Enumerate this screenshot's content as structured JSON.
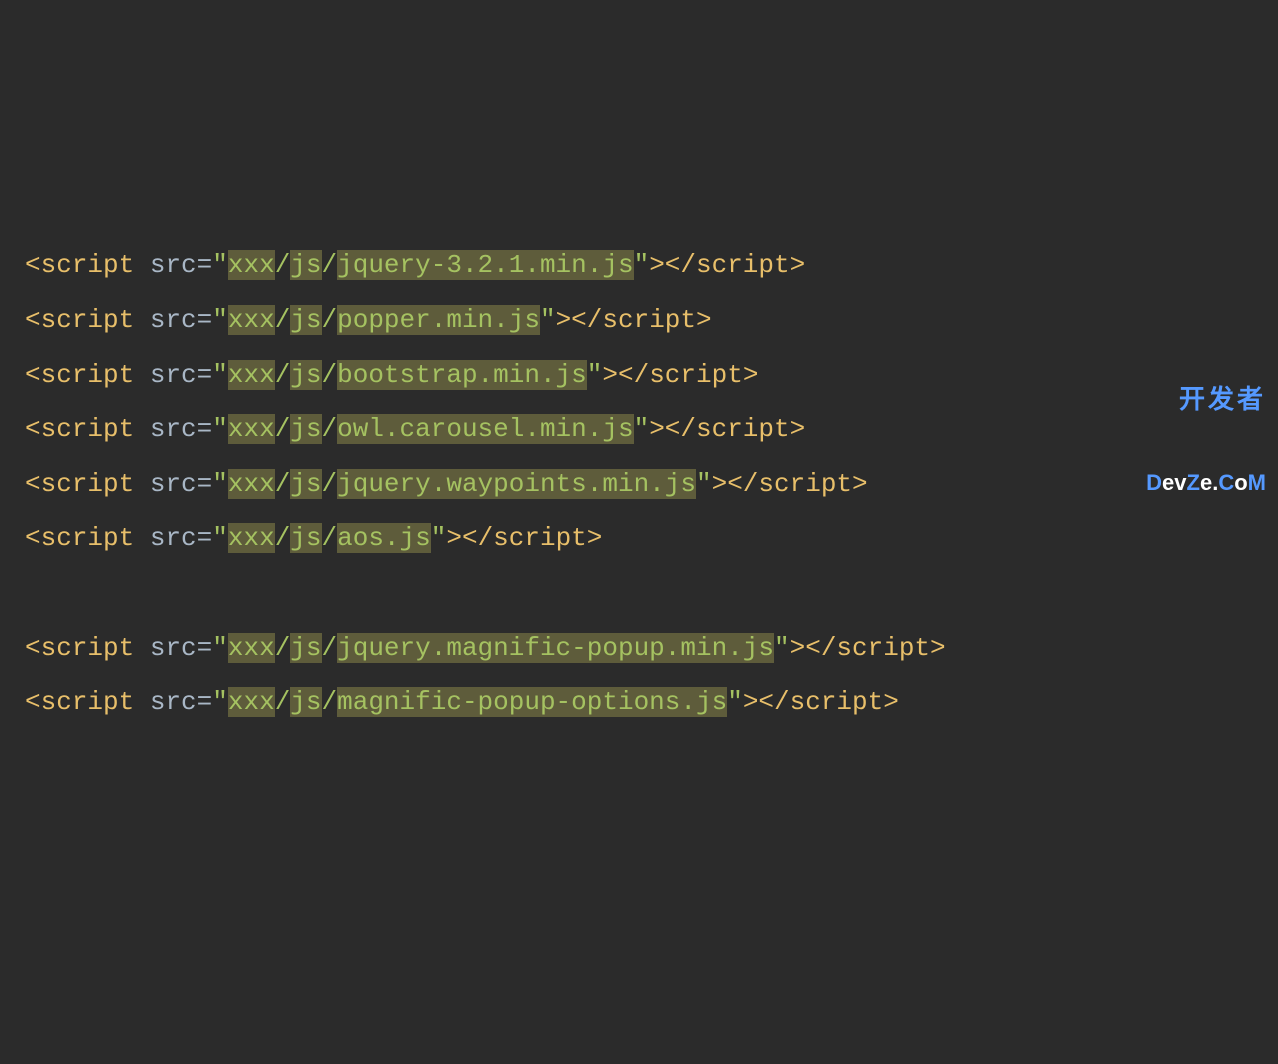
{
  "code": {
    "lines": [
      {
        "tag": "script",
        "attr": "src",
        "segments": [
          "xxx",
          "/",
          "js",
          "/",
          "jquery-3.2.1.min.js"
        ],
        "highlights": [
          true,
          false,
          true,
          false,
          true
        ]
      },
      {
        "tag": "script",
        "attr": "src",
        "segments": [
          "xxx",
          "/",
          "js",
          "/",
          "popper.min.js"
        ],
        "highlights": [
          true,
          false,
          true,
          false,
          true
        ]
      },
      {
        "tag": "script",
        "attr": "src",
        "segments": [
          "xxx",
          "/",
          "js",
          "/",
          "bootstrap.min.js"
        ],
        "highlights": [
          true,
          false,
          true,
          false,
          true
        ]
      },
      {
        "tag": "script",
        "attr": "src",
        "segments": [
          "xxx",
          "/",
          "js",
          "/",
          "owl.carousel.min.js"
        ],
        "highlights": [
          true,
          false,
          true,
          false,
          true
        ]
      },
      {
        "tag": "script",
        "attr": "src",
        "segments": [
          "xxx",
          "/",
          "js",
          "/",
          "jquery.waypoints.min.js"
        ],
        "highlights": [
          true,
          false,
          true,
          false,
          true
        ]
      },
      {
        "tag": "script",
        "attr": "src",
        "segments": [
          "xxx",
          "/",
          "js",
          "/",
          "aos.js"
        ],
        "highlights": [
          true,
          false,
          true,
          false,
          true
        ]
      },
      {
        "blank": true
      },
      {
        "tag": "script",
        "attr": "src",
        "segments": [
          "xxx",
          "/",
          "js",
          "/",
          "jquery.magnific-popup.min.js"
        ],
        "highlights": [
          true,
          false,
          true,
          false,
          true
        ]
      },
      {
        "tag": "script",
        "attr": "src",
        "segments": [
          "xxx",
          "/",
          "js",
          "/",
          "magnific-popup-options.js"
        ],
        "highlights": [
          true,
          false,
          true,
          false,
          true
        ]
      }
    ]
  },
  "watermark": {
    "top": "开发者",
    "bottom_prefix": "D",
    "bottom_mid": "ev",
    "bottom_z": "Z",
    "bottom_e": "e",
    "bottom_dot": ".",
    "bottom_c": "C",
    "bottom_o": "o",
    "bottom_m": "M"
  }
}
